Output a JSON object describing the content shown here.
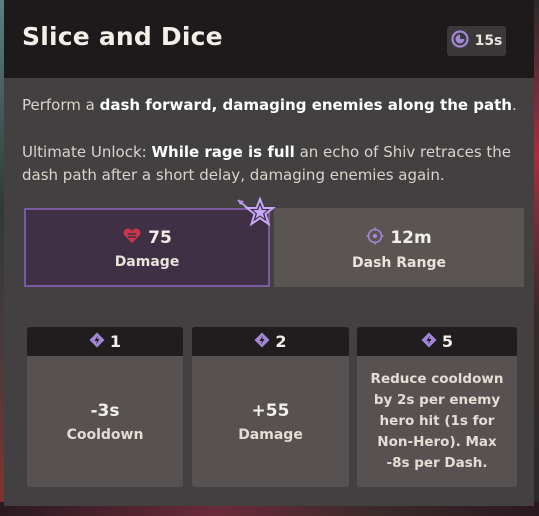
{
  "ability": {
    "title": "Slice and Dice",
    "cooldown_badge": "15s",
    "accent_color": "#7c5aa0"
  },
  "description": {
    "line1_prefix": "Perform a ",
    "line1_bold": "dash forward, damaging enemies along the path",
    "line1_suffix": ".",
    "line2_prefix": "Ultimate Unlock: ",
    "line2_bold": "While rage is full",
    "line2_suffix": " an echo of Shiv retraces the dash path after a short delay, damaging enemies again."
  },
  "stats": [
    {
      "icon": "heart-icon",
      "value": "75",
      "label": "Damage"
    },
    {
      "icon": "crosshair-icon",
      "value": "12m",
      "label": "Dash Range"
    }
  ],
  "upgrades": [
    {
      "icon": "bolt-icon",
      "tier": "1",
      "value": "-3s",
      "label": "Cooldown"
    },
    {
      "icon": "bolt-icon",
      "tier": "2",
      "value": "+55",
      "label": "Damage"
    },
    {
      "icon": "bolt-icon",
      "tier": "5",
      "text": "Reduce cooldown by 2s per enemy hero hit (1s for Non-Hero). Max -8s per Dash."
    }
  ]
}
